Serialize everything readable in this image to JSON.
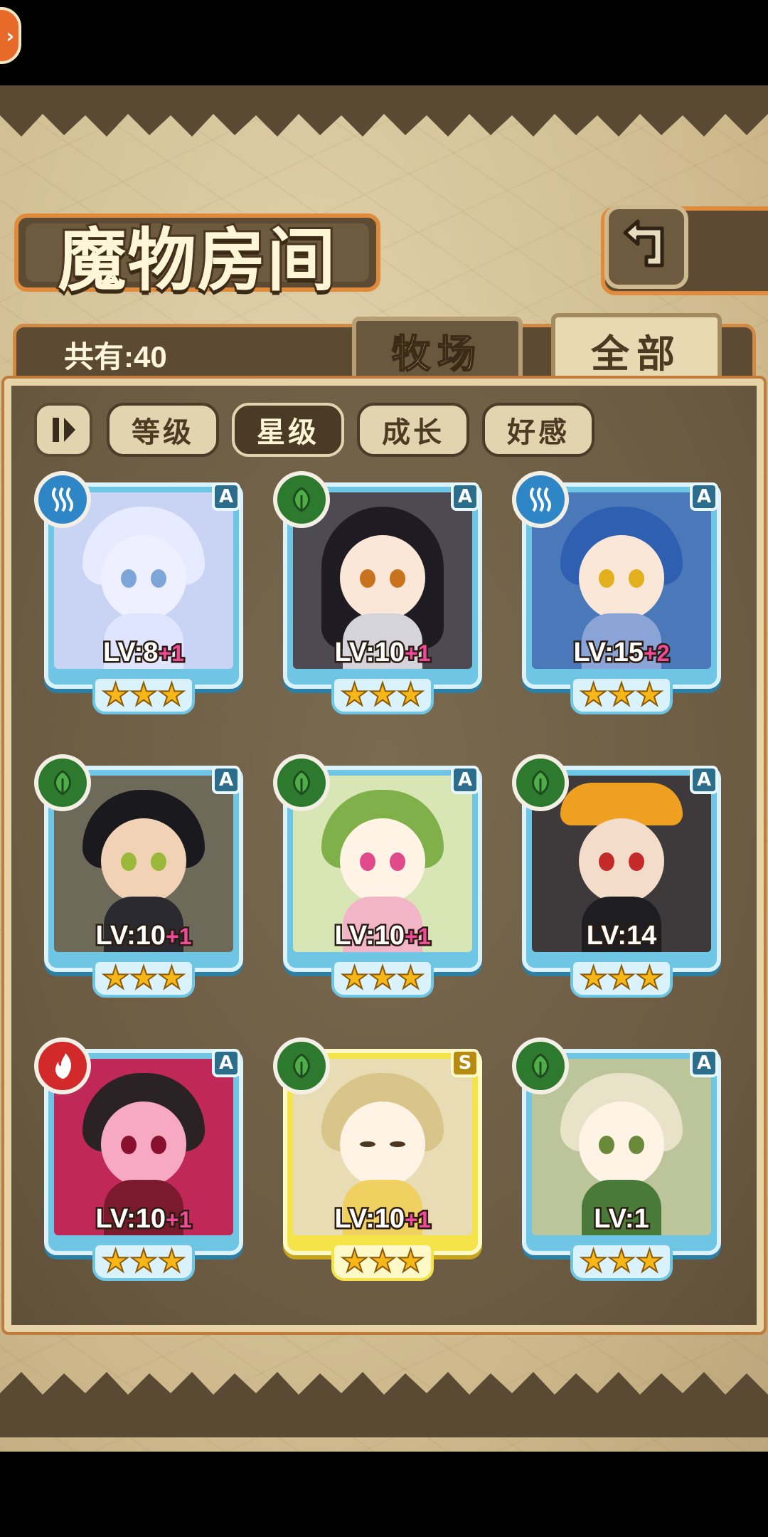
{
  "header": {
    "title": "魔物房间",
    "count_label": "共有:40"
  },
  "tabs": [
    {
      "label": "牧场",
      "selected": false
    },
    {
      "label": "全部",
      "selected": true
    }
  ],
  "sort": {
    "buttons": [
      {
        "label": "等级",
        "active": false
      },
      {
        "label": "星级",
        "active": true
      },
      {
        "label": "成长",
        "active": false
      },
      {
        "label": "好感",
        "active": false
      }
    ]
  },
  "monsters": [
    {
      "level_text": "LV:8",
      "bonus": "+1",
      "rarity": "A",
      "element": "water-icon",
      "stars": 3
    },
    {
      "level_text": "LV:10",
      "bonus": "+1",
      "rarity": "A",
      "element": "leaf-icon",
      "stars": 3
    },
    {
      "level_text": "LV:15",
      "bonus": "+2",
      "rarity": "A",
      "element": "water-icon",
      "stars": 3
    },
    {
      "level_text": "LV:10",
      "bonus": "+1",
      "rarity": "A",
      "element": "leaf-icon",
      "stars": 3
    },
    {
      "level_text": "LV:10",
      "bonus": "+1",
      "rarity": "A",
      "element": "leaf-icon",
      "stars": 3
    },
    {
      "level_text": "LV:14",
      "bonus": "",
      "rarity": "A",
      "element": "leaf-icon",
      "stars": 3
    },
    {
      "level_text": "LV:10",
      "bonus": "+1",
      "rarity": "A",
      "element": "fire-icon",
      "stars": 3
    },
    {
      "level_text": "LV:10",
      "bonus": "+1",
      "rarity": "S",
      "element": "leaf-icon",
      "stars": 3
    },
    {
      "level_text": "LV:1",
      "bonus": "",
      "rarity": "A",
      "element": "leaf-icon",
      "stars": 3
    }
  ],
  "colors": {
    "card_frame": "#6fc6e4",
    "card_frame_gold": "#f5e34a",
    "water": "#2f86c6",
    "grass": "#2d7a2f",
    "fire": "#d2292b",
    "bonus_pink": "#f04a9a",
    "accent_orange": "#e08a3c"
  }
}
